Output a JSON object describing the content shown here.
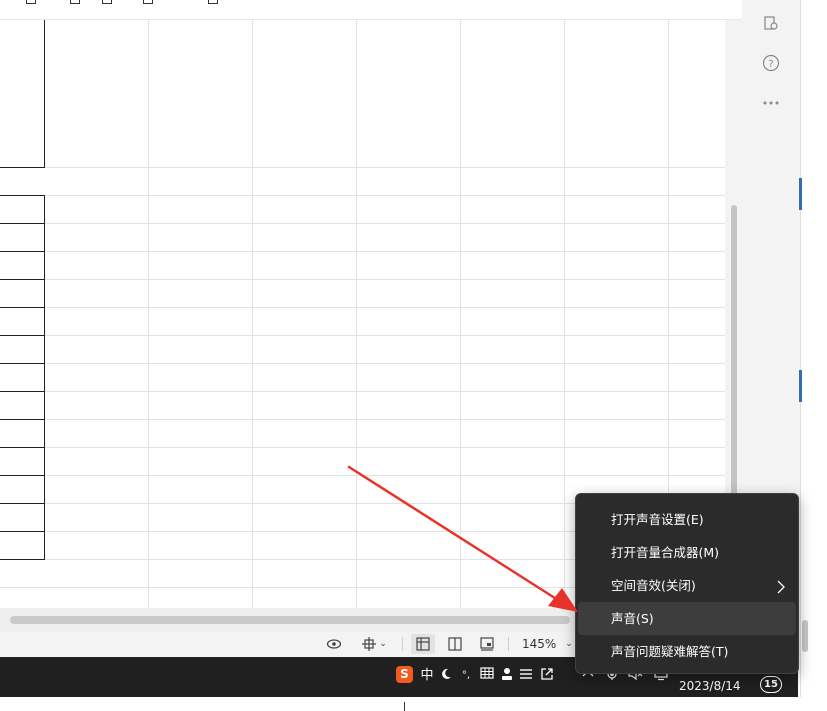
{
  "status_bar": {
    "zoom_level": "145%"
  },
  "taskbar": {
    "tray": {
      "ime_label": "中",
      "date": "2023/8/14",
      "notification_count": "15"
    }
  },
  "context_menu": {
    "items": [
      {
        "label": "打开声音设置(E)"
      },
      {
        "label": "打开音量合成器(M)"
      },
      {
        "label": "空间音效(关闭)",
        "has_submenu": true
      },
      {
        "label": "声音(S)",
        "highlighted": true
      },
      {
        "label": "声音问题疑难解答(T)"
      }
    ]
  },
  "annotation": {
    "arrow_color": "#e8322a"
  },
  "colors": {
    "taskbar_bg": "#202020",
    "menu_bg": "#2b2b2b",
    "menu_hover": "#3d3d3d",
    "sogou_brand": "#f25b1f"
  },
  "icons": {
    "side_panel": [
      "find-icon",
      "help-icon",
      "more-icon"
    ],
    "status_bar": [
      "eye-icon",
      "crosshair-icon",
      "normal-view-icon",
      "page-layout-icon",
      "page-break-icon",
      "chevron-down-icon"
    ],
    "tray": [
      "sogou-icon",
      "moon-icon",
      "punctuation-icon",
      "keyboard-icon",
      "user-icon",
      "menu-icon",
      "share-icon",
      "chevron-up-icon",
      "microphone-icon",
      "speaker-muted-icon",
      "network-icon"
    ]
  }
}
